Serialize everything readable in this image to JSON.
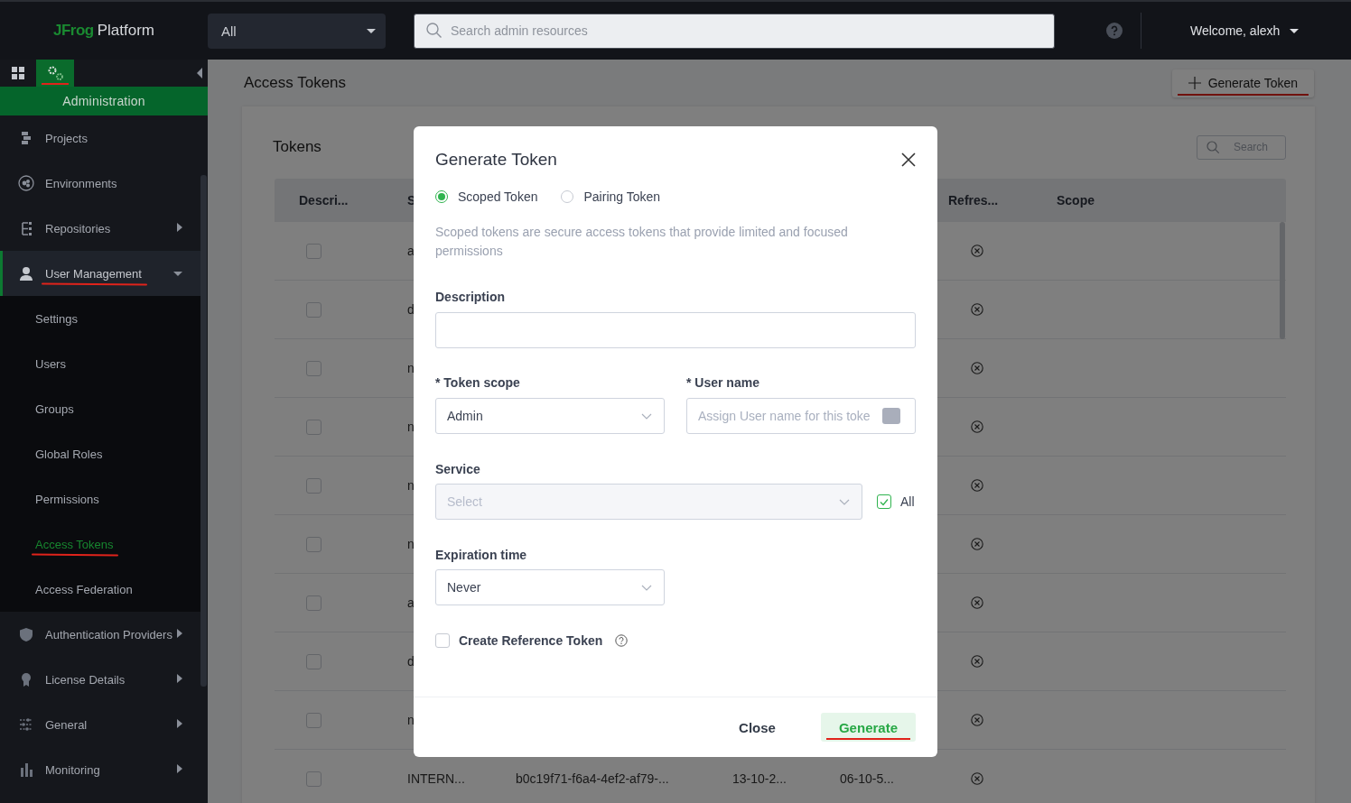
{
  "top_bar": {
    "logo": {
      "brand": "JFrog",
      "product": "Platform"
    },
    "scope_dropdown": {
      "value": "All"
    },
    "search": {
      "placeholder": "Search admin resources"
    },
    "user_menu": {
      "label": "Welcome, alexh"
    }
  },
  "sidebar": {
    "modules": [
      {
        "kind": "grid",
        "selected": false,
        "underlined": false
      },
      {
        "kind": "gear",
        "selected": true,
        "underlined": true
      }
    ],
    "section_title": "Administration",
    "items": [
      {
        "label": "Projects",
        "kind": "projects",
        "expandable": false,
        "expanded": false,
        "underlined": false
      },
      {
        "label": "Environments",
        "kind": "environments",
        "expandable": false,
        "expanded": false,
        "underlined": false
      },
      {
        "label": "Repositories",
        "kind": "repositories",
        "expandable": true,
        "expanded": false,
        "underlined": false
      },
      {
        "label": "User Management",
        "kind": "user",
        "expandable": true,
        "expanded": true,
        "underlined": true,
        "children": [
          {
            "label": "Settings",
            "selected": false,
            "underlined": false
          },
          {
            "label": "Users",
            "selected": false,
            "underlined": false
          },
          {
            "label": "Groups",
            "selected": false,
            "underlined": false
          },
          {
            "label": "Global Roles",
            "selected": false,
            "underlined": false
          },
          {
            "label": "Permissions",
            "selected": false,
            "underlined": false
          },
          {
            "label": "Access Tokens",
            "selected": true,
            "underlined": true
          },
          {
            "label": "Access Federation",
            "selected": false,
            "underlined": false
          }
        ]
      },
      {
        "label": "Authentication Providers",
        "kind": "shield",
        "expandable": true,
        "expanded": false,
        "underlined": false
      },
      {
        "label": "License Details",
        "kind": "badge",
        "expandable": true,
        "expanded": false,
        "underlined": false
      },
      {
        "label": "General",
        "kind": "sliders",
        "expandable": true,
        "expanded": false,
        "underlined": false
      },
      {
        "label": "Monitoring",
        "kind": "bars",
        "expandable": true,
        "expanded": false,
        "underlined": false
      }
    ]
  },
  "page": {
    "title": "Access Tokens",
    "generate_button": {
      "label": "Generate Token",
      "underlined": true
    },
    "tokens_card": {
      "title": "Tokens",
      "search": {
        "placeholder": "Search"
      },
      "table": {
        "columns": [
          "Descri...",
          "S",
          "",
          "",
          "",
          "Refres...",
          "Scope"
        ],
        "rows": [
          {
            "checked": false,
            "cells": [
              "",
              "a"
            ]
          },
          {
            "checked": false,
            "cells": [
              "",
              "d"
            ]
          },
          {
            "checked": false,
            "cells": [
              "",
              "n"
            ]
          },
          {
            "checked": false,
            "cells": [
              "",
              "n"
            ]
          },
          {
            "checked": false,
            "cells": [
              "",
              "n"
            ]
          },
          {
            "checked": false,
            "cells": [
              "",
              "n"
            ]
          },
          {
            "checked": false,
            "cells": [
              "",
              "a"
            ]
          },
          {
            "checked": false,
            "cells": [
              "",
              "d"
            ]
          },
          {
            "checked": false,
            "cells": [
              "",
              "n"
            ]
          },
          {
            "checked": false,
            "cells": [
              "",
              "INTERN...",
              "b0c19f71-f6a4-4ef2-af79-...",
              "13-10-2...",
              "06-10-5..."
            ]
          }
        ]
      }
    }
  },
  "dialog": {
    "title": "Generate Token",
    "token_types": [
      {
        "label": "Scoped Token",
        "selected": true
      },
      {
        "label": "Pairing Token",
        "selected": false
      }
    ],
    "description_text": "Scoped tokens are secure access tokens that provide limited and focused permissions",
    "description": {
      "label": "Description"
    },
    "token_scope": {
      "label": "* Token scope",
      "value": "Admin"
    },
    "user_name": {
      "label": "* User name",
      "placeholder": "Assign User name for this toke"
    },
    "service": {
      "label": "Service",
      "placeholder": "Select",
      "disabled": true,
      "all": {
        "label": "All",
        "checked": true
      }
    },
    "expiration": {
      "label": "Expiration time",
      "value": "Never"
    },
    "reference_token": {
      "label": "Create Reference Token",
      "checked": false
    },
    "buttons": [
      {
        "label": "Close",
        "kind": "plain",
        "underlined": false
      },
      {
        "label": "Generate",
        "kind": "primary",
        "underlined": true
      }
    ]
  }
}
